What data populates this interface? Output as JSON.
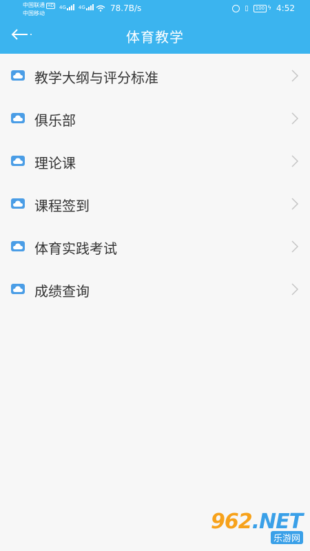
{
  "status_bar": {
    "carrier1": "中国联通",
    "hd": "HD",
    "carrier2": "中国移动",
    "network1": "4G",
    "network2": "4G",
    "speed": "78.7B/s",
    "battery": "100",
    "time": "4:52"
  },
  "header": {
    "title": "体育教学"
  },
  "menu": {
    "items": [
      {
        "label": "教学大纲与评分标准"
      },
      {
        "label": "俱乐部"
      },
      {
        "label": "理论课"
      },
      {
        "label": "课程签到"
      },
      {
        "label": "体育实践考试"
      },
      {
        "label": "成绩查询"
      }
    ]
  },
  "watermark": {
    "logo_main": "962",
    "logo_suffix": ".NET",
    "sub": "乐游网"
  },
  "colors": {
    "header_bg": "#3bb4ef",
    "icon_blue": "#4a9de6",
    "page_bg": "#f7f7f7"
  }
}
